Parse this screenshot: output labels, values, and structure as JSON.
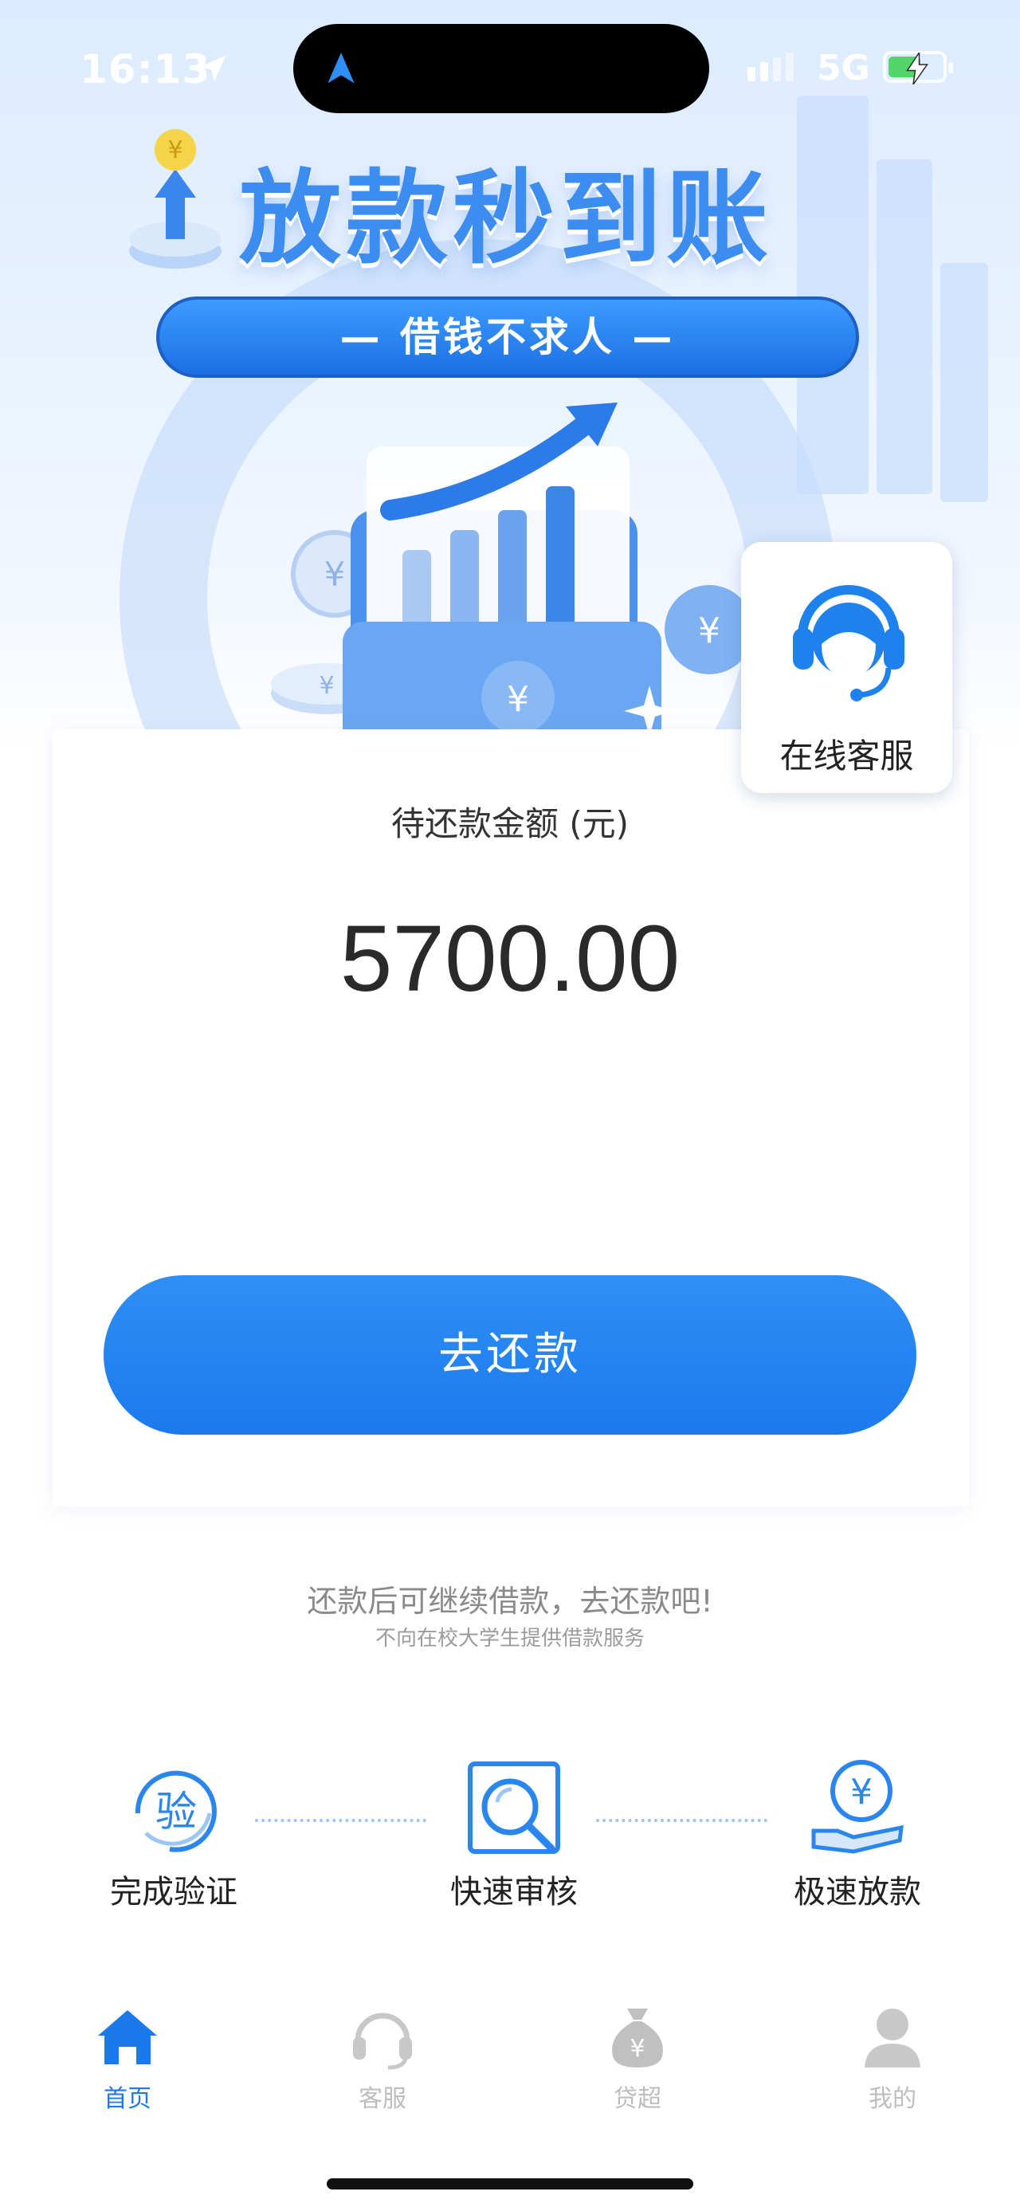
{
  "status_bar": {
    "time": "16:13",
    "network": "5G"
  },
  "hero": {
    "title": "放款秒到账",
    "slogan": "— 借钱不求人 —"
  },
  "customer_service_float": {
    "label": "在线客服"
  },
  "repayment": {
    "label": "待还款金额 (元)",
    "amount": "5700.00",
    "button": "去还款"
  },
  "notice": {
    "primary": "还款后可继续借款，去还款吧!",
    "secondary": "不向在校大学生提供借款服务"
  },
  "steps": [
    {
      "label": "完成验证",
      "icon_text": "验"
    },
    {
      "label": "快速审核"
    },
    {
      "label": "极速放款",
      "icon_text": "¥"
    }
  ],
  "tabs": [
    {
      "label": "首页",
      "active": true,
      "icon": "home-icon"
    },
    {
      "label": "客服",
      "active": false,
      "icon": "headset-icon"
    },
    {
      "label": "贷超",
      "active": false,
      "icon": "money-bag-icon"
    },
    {
      "label": "我的",
      "active": false,
      "icon": "user-icon"
    }
  ],
  "colors": {
    "primary": "#1a7aed",
    "hero_title": "#3d8cf0",
    "tab_active": "#1a7aed",
    "tab_inactive": "#bdbdbd"
  }
}
